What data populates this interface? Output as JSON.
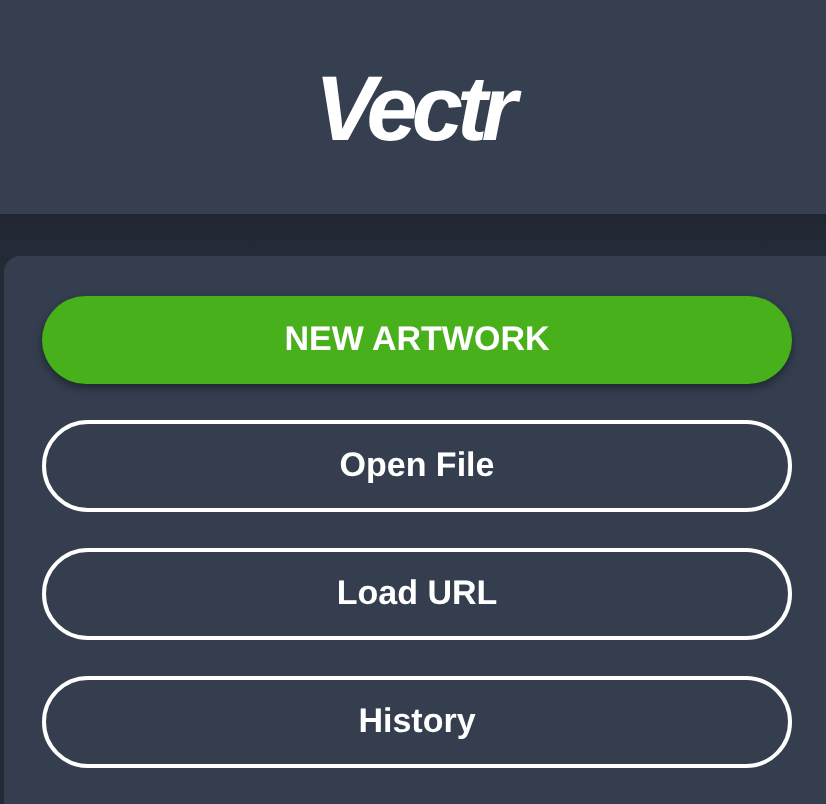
{
  "header": {
    "logo": "Vectr"
  },
  "buttons": [
    {
      "label": "NEW ARTWORK",
      "kind": "primary"
    },
    {
      "label": "Open File",
      "kind": "outline"
    },
    {
      "label": "Load URL",
      "kind": "outline"
    },
    {
      "label": "History",
      "kind": "outline"
    }
  ]
}
